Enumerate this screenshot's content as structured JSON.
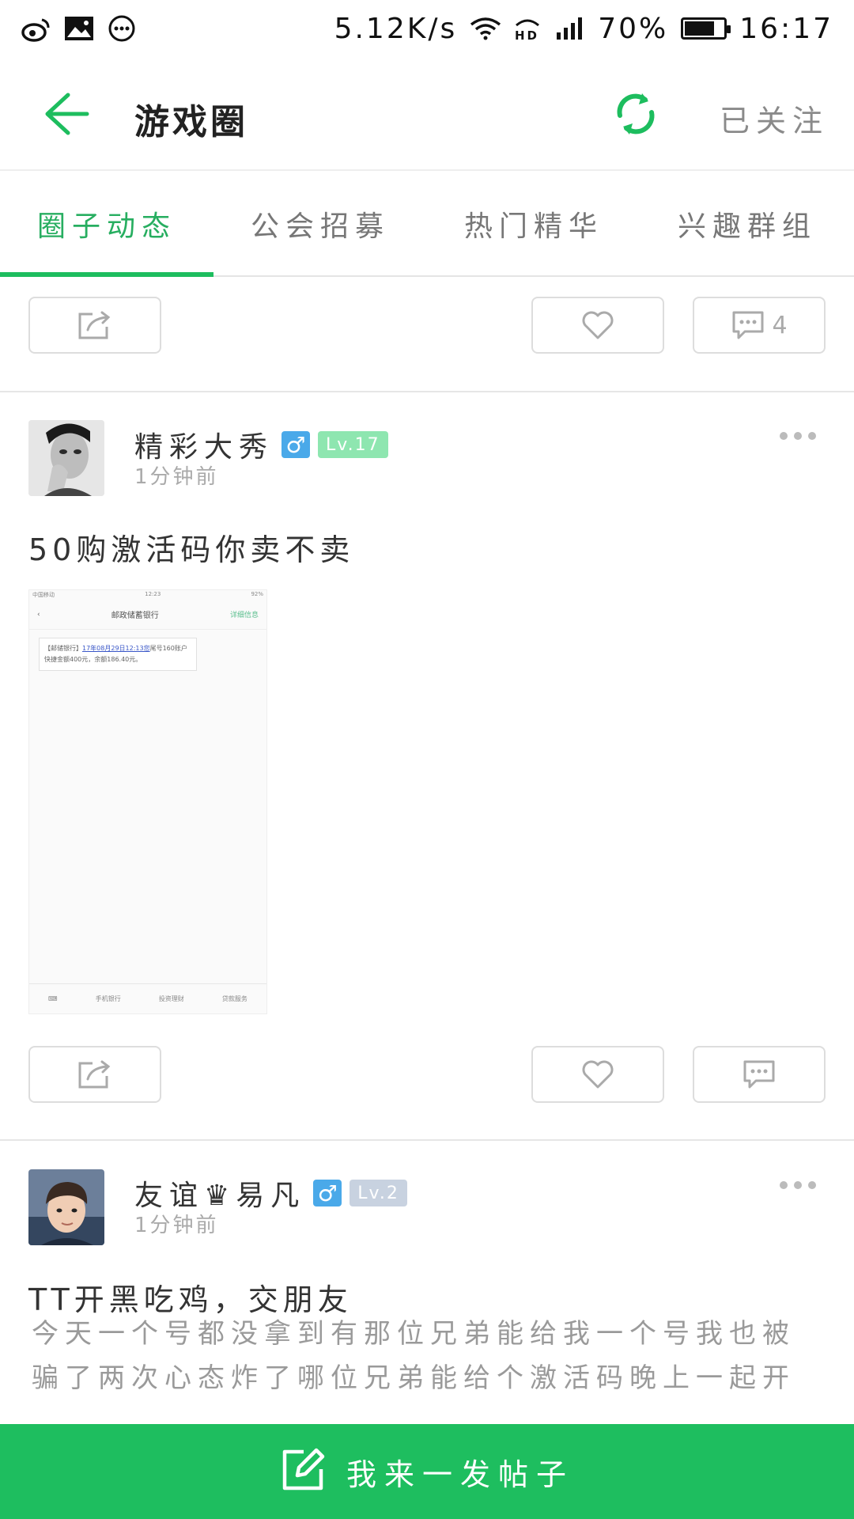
{
  "status_bar": {
    "network_speed": "5.12K/s",
    "battery_level": "70%",
    "battery_fraction": 0.7,
    "time": "16:17",
    "left_icons": [
      "weibo-icon",
      "image-icon",
      "more-circle-icon"
    ],
    "right_icons": [
      "wifi-icon",
      "hd-icon",
      "signal-icon",
      "battery-icon"
    ]
  },
  "header": {
    "title": "游戏圈",
    "follow_label": "已关注"
  },
  "tabs": [
    {
      "label": "圈子动态",
      "active": true
    },
    {
      "label": "公会招募",
      "active": false
    },
    {
      "label": "热门精华",
      "active": false
    },
    {
      "label": "兴趣群组",
      "active": false
    }
  ],
  "first_actions": {
    "comment_count": "4"
  },
  "posts": [
    {
      "username": "精彩大秀",
      "gender": "♂",
      "level": "Lv.17",
      "time": "1分钟前",
      "title": "50购激活码你卖不卖",
      "image": {
        "status_left": "中国移动",
        "status_time": "12:23",
        "status_right": "92%",
        "nav_title": "邮政储蓄银行",
        "nav_link": "详细信息",
        "message_prefix": "【邮储银行】",
        "message_link": "17年08月29日12:13您",
        "message_rest": "尾号160账户快捷金额400元，余额186.40元。",
        "footer": [
          "手机银行",
          "投资理财",
          "贷款服务"
        ]
      }
    },
    {
      "username": "友谊♛易凡",
      "gender": "♂",
      "level": "Lv.2",
      "time": "1分钟前",
      "title": "TT开黑吃鸡，交朋友",
      "body": "今天一个号都没拿到有那位兄弟能给我一个号我也被骗了两次心态炸了哪位兄弟能给个激活码晚上一起开黑吃鸡!"
    }
  ],
  "bottom_bar": {
    "label": "我来一发帖子"
  },
  "colors": {
    "accent_green": "#1ebe5f",
    "tab_active": "#27ae60",
    "gender_blue": "#4aa9e9"
  }
}
